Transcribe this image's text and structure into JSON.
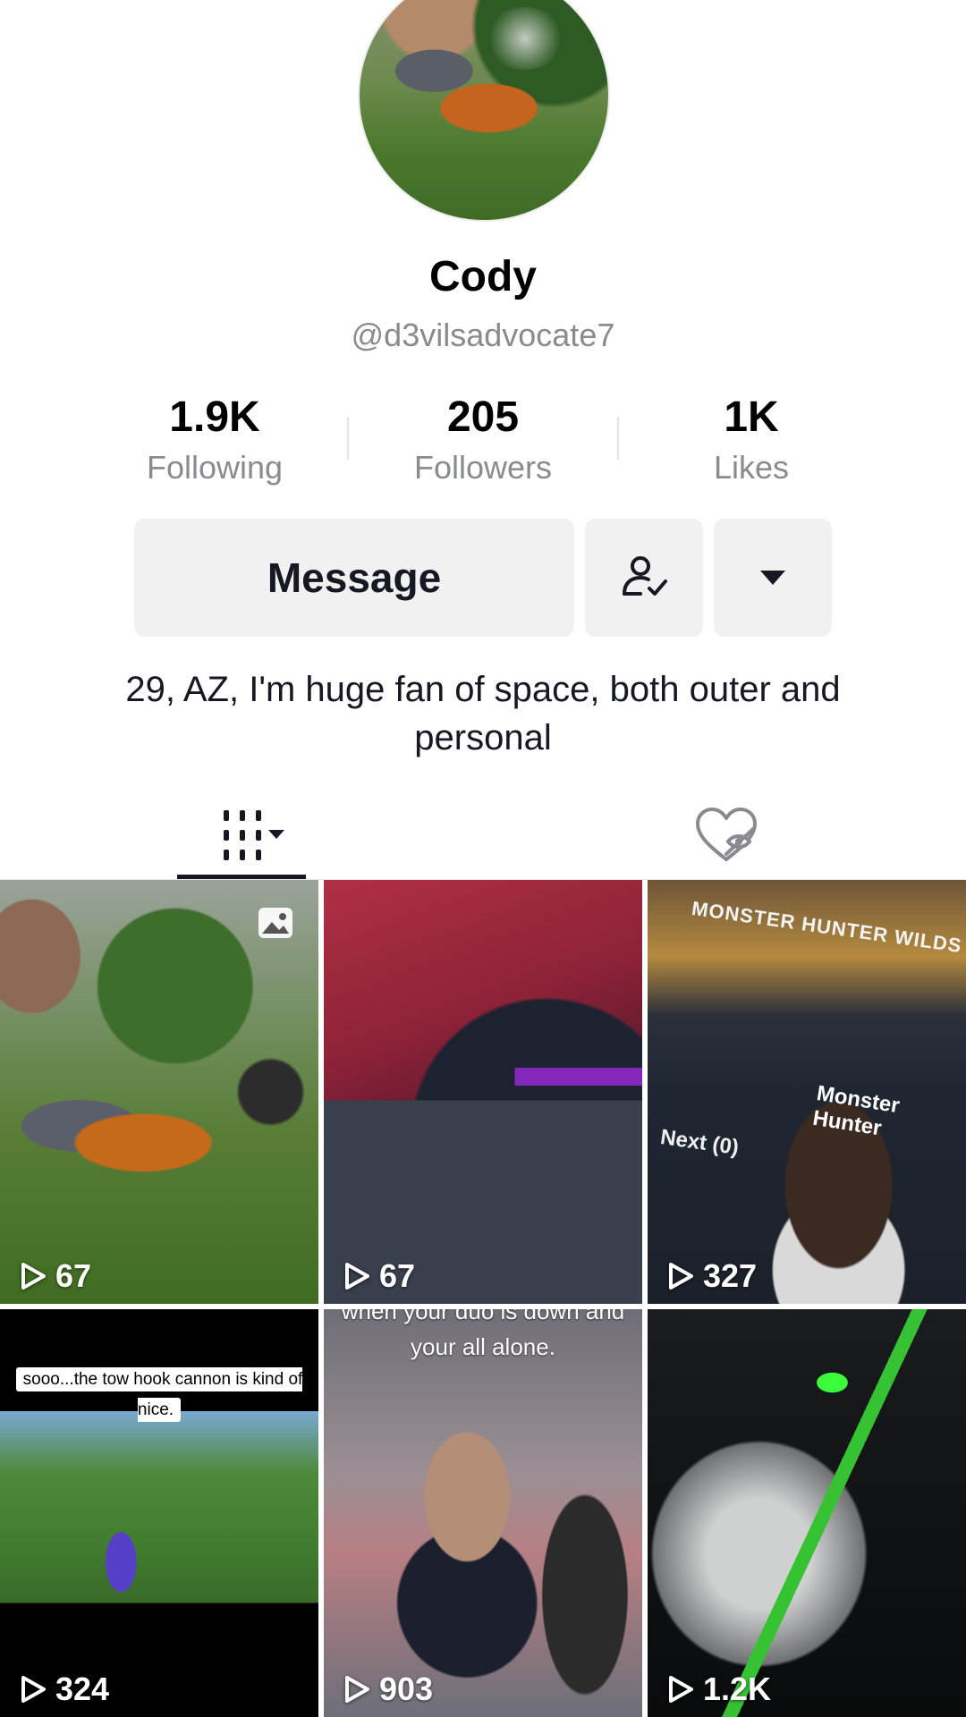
{
  "profile": {
    "name": "Cody",
    "handle": "@d3vilsadvocate7",
    "bio": "29, AZ, I'm huge fan of space, both outer and personal"
  },
  "stats": [
    {
      "value": "1.9K",
      "label": "Following"
    },
    {
      "value": "205",
      "label": "Followers"
    },
    {
      "value": "1K",
      "label": "Likes"
    }
  ],
  "actions": {
    "message_label": "Message",
    "following_icon": "person-check-icon",
    "more_icon": "caret-down-icon"
  },
  "tabs": {
    "videos_icon": "grid-videos-icon",
    "liked_icon": "hidden-liked-icon"
  },
  "videos": [
    {
      "views": "67",
      "photo_badge": true
    },
    {
      "views": "67"
    },
    {
      "views": "327",
      "title_text": "MONSTER HUNTER WILDS",
      "subtitle_text": "Monster Hunter",
      "next_text": "Next (0)"
    },
    {
      "views": "324",
      "caption": "sooo...the tow hook cannon is kind of nice."
    },
    {
      "views": "903",
      "caption": "when your duo is down and your all alone."
    },
    {
      "views": "1.2K"
    }
  ]
}
